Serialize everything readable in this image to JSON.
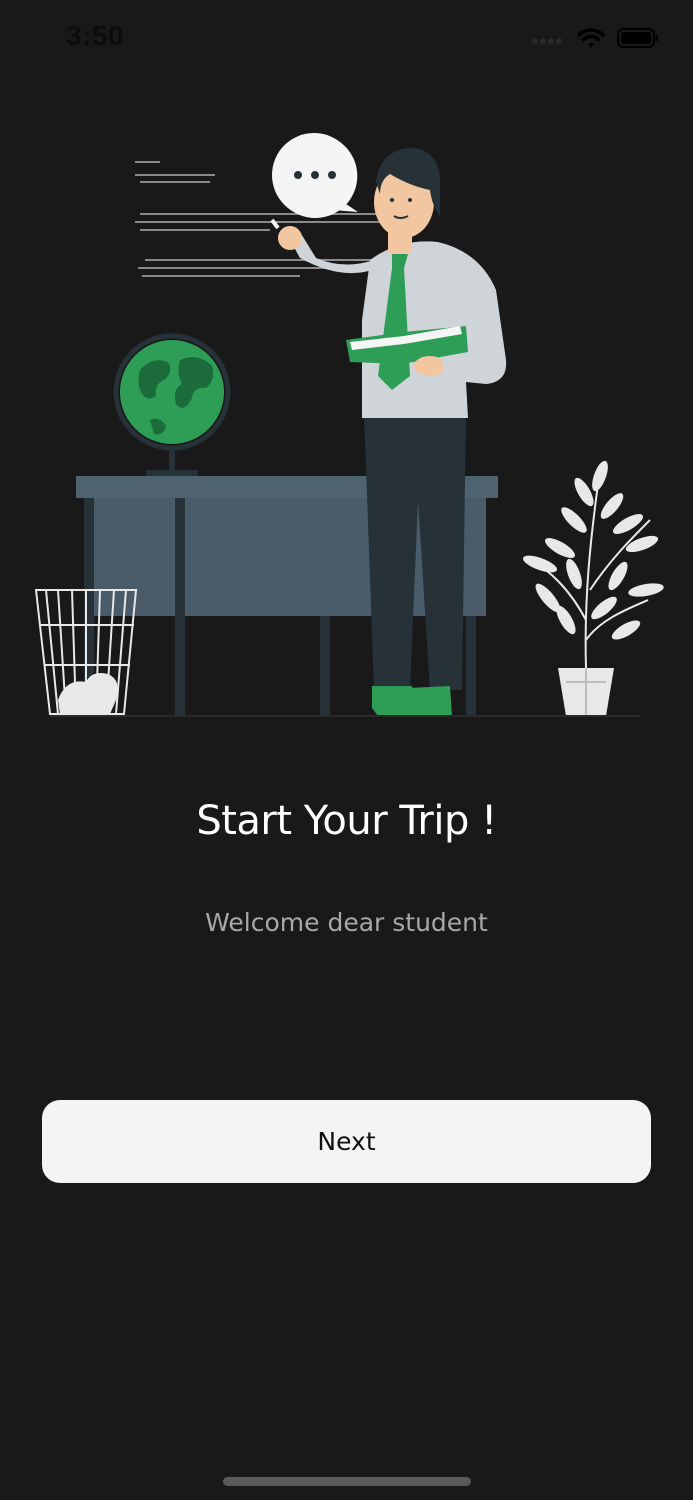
{
  "status_bar": {
    "time": "3:50",
    "icons": [
      "cellular-signal-icon",
      "wifi-icon",
      "battery-icon"
    ]
  },
  "illustration": {
    "name": "teacher-at-desk-illustration",
    "elements": [
      "teacher",
      "speech-bubble",
      "globe",
      "desk",
      "waste-basket",
      "potted-plant",
      "book"
    ],
    "accent_color": "#2e9e57",
    "speech_bubble_text": "•••"
  },
  "onboarding": {
    "title": "Start Your Trip !",
    "subtitle": "Welcome dear student"
  },
  "actions": {
    "next_label": "Next"
  },
  "colors": {
    "background": "#191919",
    "button_background": "#f4f4f4",
    "title_text": "#ffffff",
    "subtitle_text": "#a8a8a8"
  }
}
